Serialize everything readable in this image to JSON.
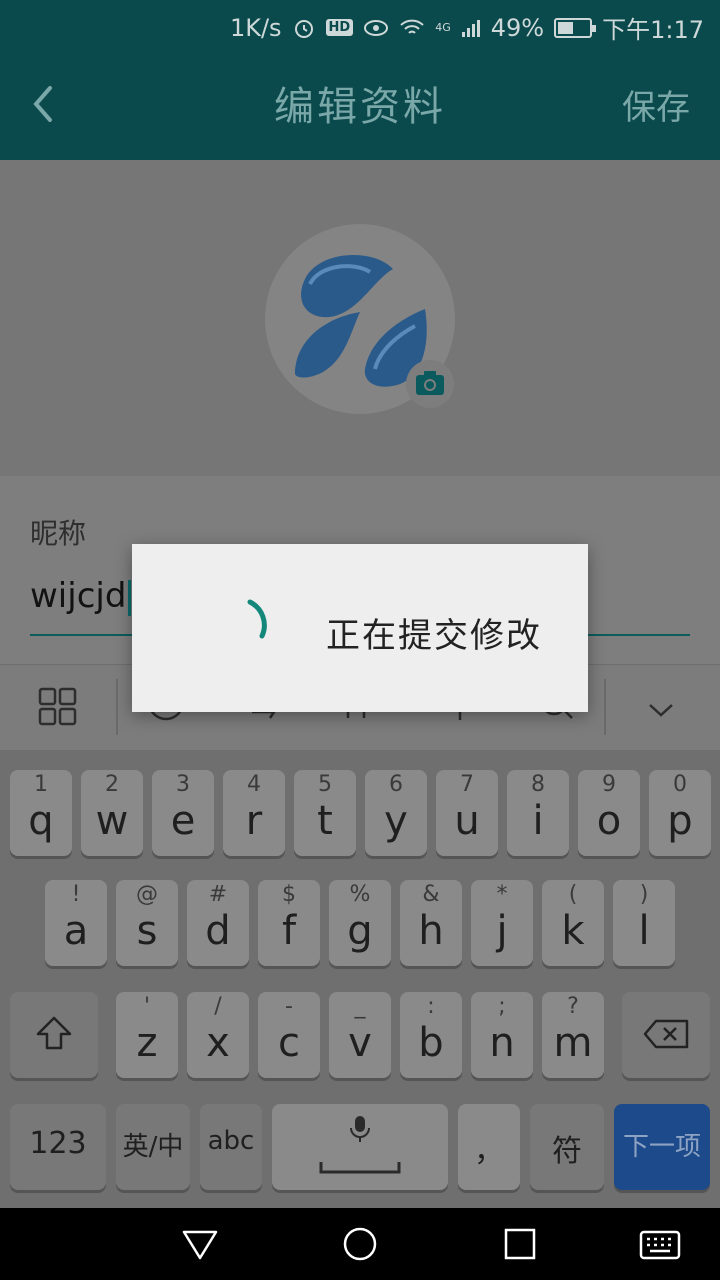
{
  "status_bar": {
    "net_speed": "1K/s",
    "hd": "HD",
    "signal": "4G",
    "battery": "49%",
    "time": "下午1:17"
  },
  "header": {
    "back_icon": "chevron-left-icon",
    "title": "编辑资料",
    "save_label": "保存"
  },
  "profile": {
    "avatar_icon": "water-drops-icon",
    "camera_icon": "camera-icon"
  },
  "form": {
    "nickname_label": "昵称",
    "nickname_value": "wijcjd"
  },
  "dialog": {
    "message": "正在提交修改"
  },
  "keyboard": {
    "row1": [
      {
        "sub": "1",
        "main": "q"
      },
      {
        "sub": "2",
        "main": "w"
      },
      {
        "sub": "3",
        "main": "e"
      },
      {
        "sub": "4",
        "main": "r"
      },
      {
        "sub": "5",
        "main": "t"
      },
      {
        "sub": "6",
        "main": "y"
      },
      {
        "sub": "7",
        "main": "u"
      },
      {
        "sub": "8",
        "main": "i"
      },
      {
        "sub": "9",
        "main": "o"
      },
      {
        "sub": "0",
        "main": "p"
      }
    ],
    "row2": [
      {
        "sub": "!",
        "main": "a"
      },
      {
        "sub": "@",
        "main": "s"
      },
      {
        "sub": "#",
        "main": "d"
      },
      {
        "sub": "$",
        "main": "f"
      },
      {
        "sub": "%",
        "main": "g"
      },
      {
        "sub": "&",
        "main": "h"
      },
      {
        "sub": "*",
        "main": "j"
      },
      {
        "sub": "(",
        "main": "k"
      },
      {
        "sub": ")",
        "main": "l"
      }
    ],
    "row3": [
      {
        "sub": "'",
        "main": "z"
      },
      {
        "sub": "/",
        "main": "x"
      },
      {
        "sub": "-",
        "main": "c"
      },
      {
        "sub": "_",
        "main": "v"
      },
      {
        "sub": ":",
        "main": "b"
      },
      {
        "sub": ";",
        "main": "n"
      },
      {
        "sub": "?",
        "main": "m"
      }
    ],
    "key_123": "123",
    "key_lang": "英/中",
    "key_abc": "abc",
    "key_comma": "，",
    "key_symbol": "符",
    "key_next": "下一项"
  }
}
